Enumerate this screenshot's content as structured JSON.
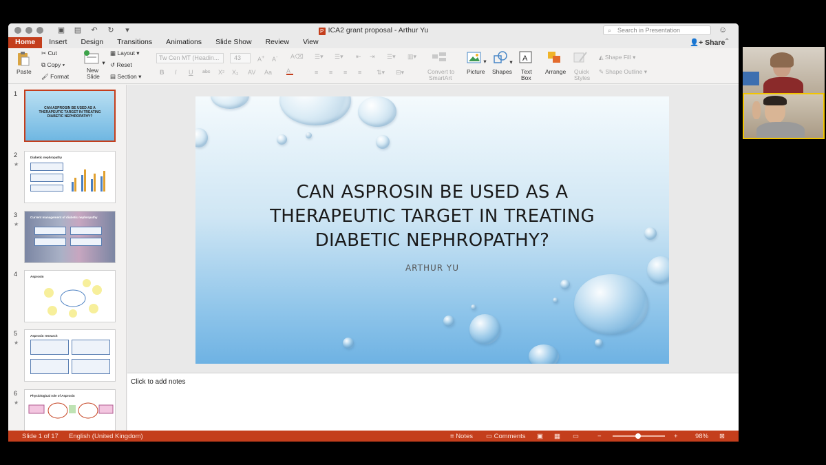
{
  "window": {
    "title": "ICA2 grant proposal - Arthur Yu",
    "search_placeholder": "Search in Presentation"
  },
  "tabs": [
    {
      "label": "Home",
      "active": true
    },
    {
      "label": "Insert"
    },
    {
      "label": "Design"
    },
    {
      "label": "Transitions"
    },
    {
      "label": "Animations"
    },
    {
      "label": "Slide Show"
    },
    {
      "label": "Review"
    },
    {
      "label": "View"
    }
  ],
  "share_label": "Share",
  "ribbon": {
    "paste": "Paste",
    "cut": "Cut",
    "copy": "Copy",
    "format": "Format",
    "new_slide_1": "New",
    "new_slide_2": "Slide",
    "layout": "Layout",
    "reset": "Reset",
    "section": "Section",
    "font_name": "Tw Cen MT (Headin...",
    "font_size": "43",
    "convert_1": "Convert to",
    "convert_2": "SmartArt",
    "picture": "Picture",
    "shapes": "Shapes",
    "textbox_1": "Text",
    "textbox_2": "Box",
    "arrange": "Arrange",
    "quick_styles_1": "Quick",
    "quick_styles_2": "Styles",
    "shape_fill": "Shape Fill",
    "shape_outline": "Shape Outline"
  },
  "thumbnails": {
    "slide1_title": "CAN ASPROSIN BE USED AS A THERAPEUTIC TARGET IN TREATING DIABETIC NEPHROPATHY?",
    "slide2_title": "Diabetic nephropathy",
    "slide3_title": "Current management of diabetic nephropathy",
    "slide4_title": "Asprosin",
    "slide5_title": "Asprosin research",
    "slide6_title": "Physiological role of Asprosin",
    "numbers": [
      "1",
      "2",
      "3",
      "4",
      "5",
      "6"
    ]
  },
  "slide": {
    "title_line1": "CAN ASPROSIN BE USED AS A",
    "title_line2": "THERAPEUTIC TARGET IN TREATING",
    "title_line3": "DIABETIC NEPHROPATHY?",
    "subtitle": "ARTHUR YU"
  },
  "notes_placeholder": "Click to add notes",
  "status": {
    "slide_count": "Slide 1 of 17",
    "language": "English (United Kingdom)",
    "notes": "Notes",
    "comments": "Comments",
    "zoom": "98%"
  },
  "colors": {
    "accent": "#c43e1c"
  }
}
